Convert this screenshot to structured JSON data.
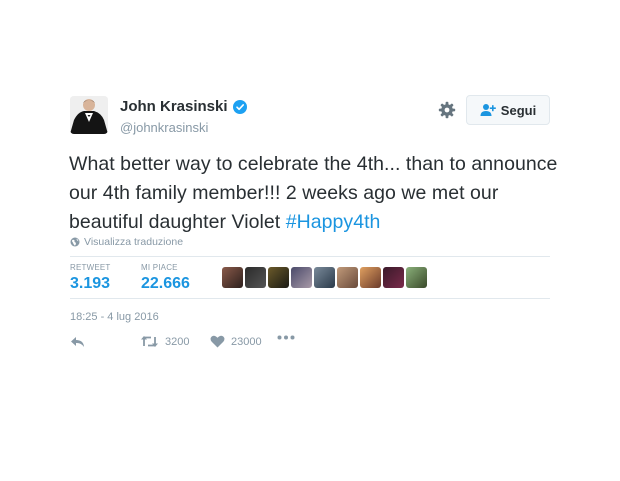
{
  "user": {
    "name": "John Krasinski",
    "handle": "@johnkrasinski",
    "verified": true
  },
  "header": {
    "settings_icon": "gear-icon",
    "follow_label": "Segui",
    "follow_icon": "add-user-icon"
  },
  "tweet": {
    "text": "What better way to celebrate the 4th... than to announce our 4th family member!!! 2 weeks ago we met our beautiful daughter Violet",
    "hashtag": "#Happy4th",
    "translate_label": "Visualizza traduzione"
  },
  "stats": {
    "retweet_label": "RETWEET",
    "retweet_value": "3.193",
    "likes_label": "MI PIACE",
    "likes_value": "22.666"
  },
  "timestamp": "18:25 - 4 lug 2016",
  "actions": {
    "reply_icon": "reply-icon",
    "retweet_count": "3200",
    "like_count": "23000",
    "more_icon": "more-icon"
  },
  "colors": {
    "link": "#1b95e0",
    "muted": "#8899a6",
    "text": "#292f33",
    "border": "#e1e8ed",
    "verified": "#1da1f2"
  }
}
